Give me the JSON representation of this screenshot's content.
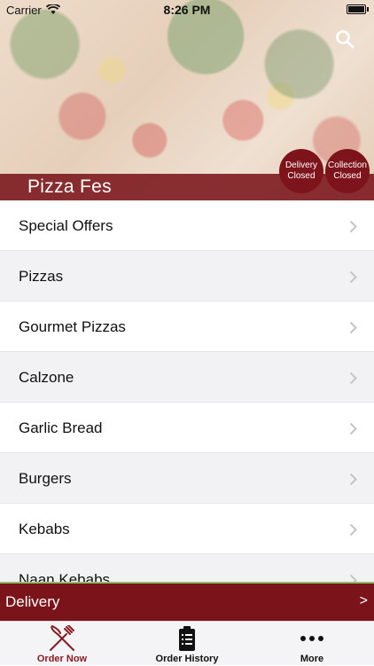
{
  "status_bar": {
    "carrier": "Carrier",
    "time": "8:26 PM"
  },
  "header": {
    "restaurant_name": "Pizza Fes",
    "delivery_status": [
      "Delivery",
      "Closed"
    ],
    "collection_status": [
      "Collection",
      "Closed"
    ]
  },
  "menu": {
    "items": [
      {
        "label": "Special Offers"
      },
      {
        "label": "Pizzas"
      },
      {
        "label": "Gourmet Pizzas"
      },
      {
        "label": "Calzone"
      },
      {
        "label": "Garlic Bread"
      },
      {
        "label": "Burgers"
      },
      {
        "label": "Kebabs"
      },
      {
        "label": "Naan Kebabs"
      }
    ]
  },
  "delivery_bar": {
    "label": "Delivery",
    "arrow": ">"
  },
  "tab_bar": {
    "tabs": [
      {
        "label": "Order Now",
        "icon": "fork-knife-icon",
        "active": true
      },
      {
        "label": "Order History",
        "icon": "clipboard-icon",
        "active": false
      },
      {
        "label": "More",
        "icon": "ellipsis-icon",
        "active": false
      }
    ]
  },
  "colors": {
    "brand": "#7a141a",
    "accent_active": "#8a1a20",
    "list_alt": "#f2f2f4"
  }
}
